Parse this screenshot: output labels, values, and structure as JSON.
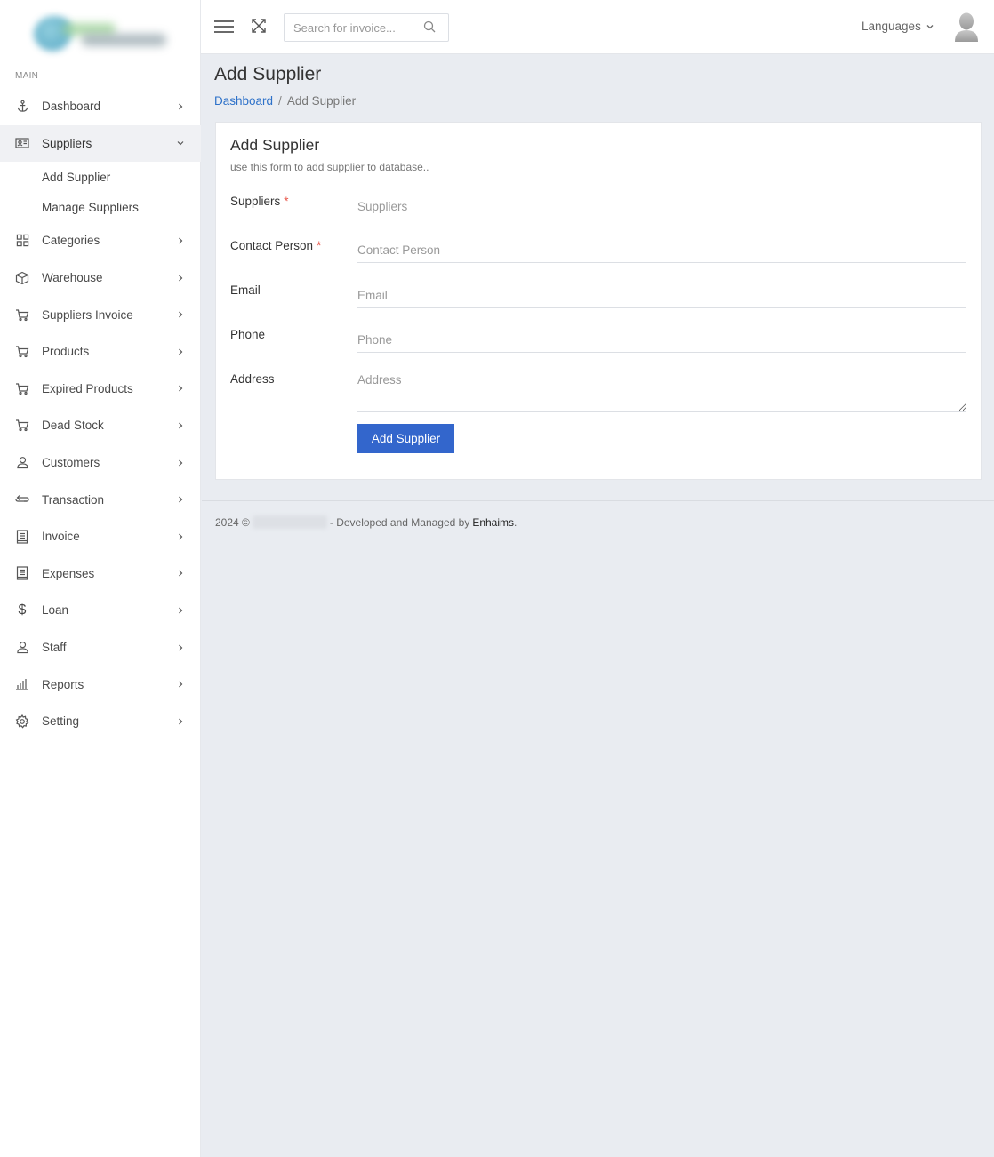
{
  "sidebar": {
    "section_label": "MAIN",
    "items": [
      {
        "label": "Dashboard",
        "icon": "anchor-icon"
      },
      {
        "label": "Suppliers",
        "icon": "id-card-icon",
        "expanded": true,
        "children": [
          {
            "label": "Add Supplier"
          },
          {
            "label": "Manage Suppliers"
          }
        ]
      },
      {
        "label": "Categories",
        "icon": "grid-icon"
      },
      {
        "label": "Warehouse",
        "icon": "box-icon"
      },
      {
        "label": "Suppliers Invoice",
        "icon": "cart-icon"
      },
      {
        "label": "Products",
        "icon": "cart-icon"
      },
      {
        "label": "Expired Products",
        "icon": "cart-icon"
      },
      {
        "label": "Dead Stock",
        "icon": "cart-icon"
      },
      {
        "label": "Customers",
        "icon": "user-icon"
      },
      {
        "label": "Transaction",
        "icon": "exchange-icon"
      },
      {
        "label": "Invoice",
        "icon": "document-icon"
      },
      {
        "label": "Expenses",
        "icon": "document-icon"
      },
      {
        "label": "Loan",
        "icon": "dollar-icon"
      },
      {
        "label": "Staff",
        "icon": "user-icon"
      },
      {
        "label": "Reports",
        "icon": "bar-chart-icon"
      },
      {
        "label": "Setting",
        "icon": "gear-icon"
      }
    ]
  },
  "topbar": {
    "search_placeholder": "Search for invoice...",
    "languages_label": "Languages"
  },
  "page": {
    "title": "Add Supplier",
    "breadcrumb": {
      "home": "Dashboard",
      "separator": "/",
      "current": "Add Supplier"
    }
  },
  "form": {
    "title": "Add Supplier",
    "subtitle": "use this form to add supplier to database..",
    "fields": [
      {
        "label": "Suppliers",
        "required": true,
        "placeholder": "Suppliers"
      },
      {
        "label": "Contact Person",
        "required": true,
        "placeholder": "Contact Person"
      },
      {
        "label": "Email",
        "required": false,
        "placeholder": "Email"
      },
      {
        "label": "Phone",
        "required": false,
        "placeholder": "Phone"
      },
      {
        "label": "Address",
        "required": false,
        "placeholder": "Address"
      }
    ],
    "required_mark": "*",
    "submit_label": "Add Supplier"
  },
  "footer": {
    "year": "2024 ©",
    "text": "- Developed and Managed by",
    "brand": "Enhaims",
    "end": "."
  },
  "colors": {
    "accent": "#3366cc",
    "link": "#2d71c9",
    "required": "#e8574a",
    "background": "#e9ecf1"
  }
}
